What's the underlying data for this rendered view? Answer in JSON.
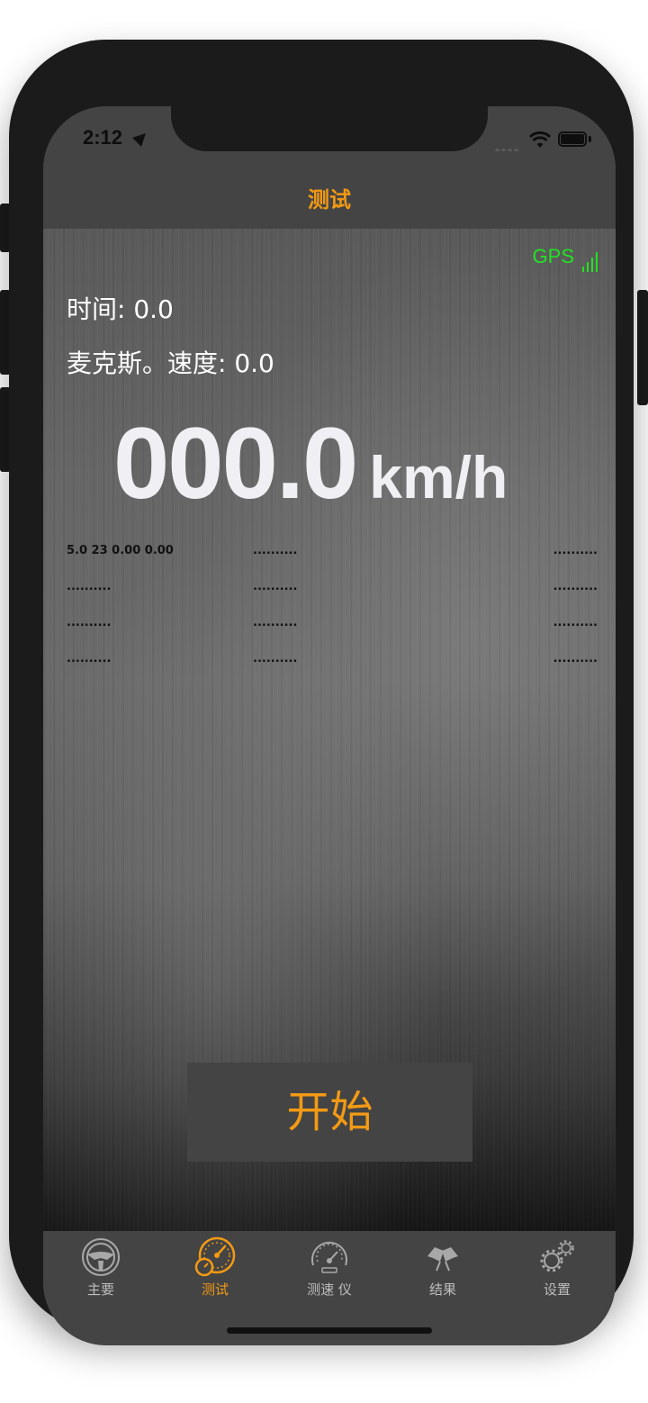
{
  "status_bar": {
    "time": "2:12"
  },
  "nav": {
    "title": "测试"
  },
  "gps": {
    "label": "GPS"
  },
  "info": {
    "time_label": "时间: 0.0",
    "max_speed_label": "麦克斯。速度: 0.0"
  },
  "speed": {
    "value": "000.0",
    "unit": "km/h"
  },
  "grid": {
    "rows": [
      [
        "5.0 23 0.00 0.00",
        "..........",
        ".........."
      ],
      [
        "..........",
        "..........",
        ".........."
      ],
      [
        "..........",
        "..........",
        ".........."
      ],
      [
        "..........",
        "..........",
        ".........."
      ]
    ]
  },
  "start_button": {
    "label": "开始"
  },
  "tabs": [
    {
      "label": "主要",
      "icon": "steering-wheel-icon",
      "active": false
    },
    {
      "label": "测试",
      "icon": "gauge-icon",
      "active": true
    },
    {
      "label": "测速 仪",
      "icon": "speedometer-icon",
      "active": false
    },
    {
      "label": "结果",
      "icon": "flags-icon",
      "active": false
    },
    {
      "label": "设置",
      "icon": "gears-icon",
      "active": false
    }
  ],
  "colors": {
    "accent": "#f39a14",
    "gps": "#22e322",
    "bar": "#444444"
  }
}
